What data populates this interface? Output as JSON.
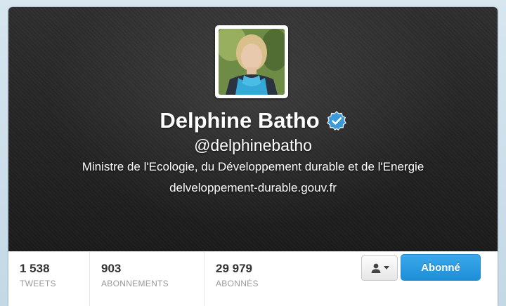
{
  "profile": {
    "name": "Delphine Batho",
    "handle": "@delphinebatho",
    "bio": "Ministre de l'Ecologie, du Développement durable et de l'Energie",
    "url": "delveloppement-durable.gouv.fr",
    "verified": true
  },
  "stats": [
    {
      "value": "1 538",
      "label": "TWEETS"
    },
    {
      "value": "903",
      "label": "ABONNEMENTS"
    },
    {
      "value": "29 979",
      "label": "ABONNÉS"
    }
  ],
  "actions": {
    "user_menu_icon": "user-dropdown-icon",
    "follow_label": "Abonné"
  },
  "colors": {
    "accent": "#1d8fd8",
    "verified": "#3a9ad9",
    "header_bg": "#242424"
  }
}
